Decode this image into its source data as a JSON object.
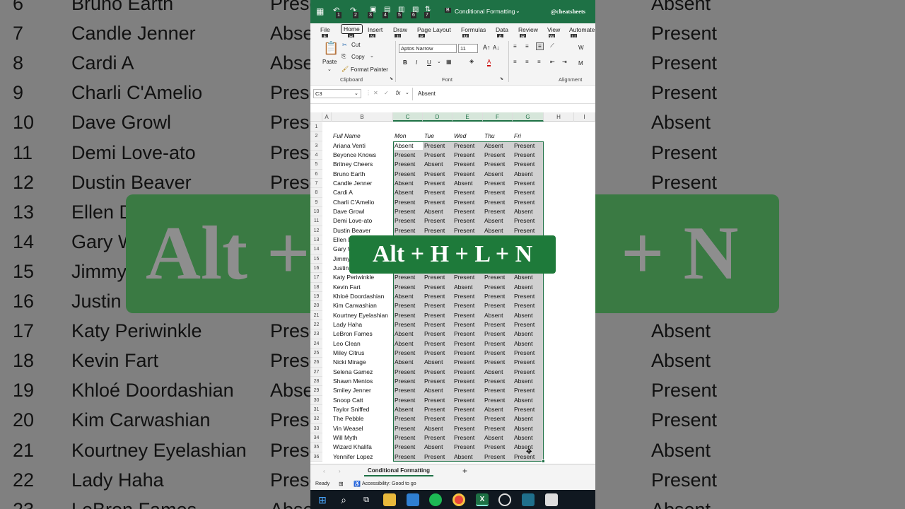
{
  "bg": {
    "rows": [
      {
        "n": "6",
        "name": "Bruno Earth",
        "c": "Present",
        "d": "Absent"
      },
      {
        "n": "7",
        "name": "Candle Jenner",
        "c": "Absent",
        "d": "Present"
      },
      {
        "n": "8",
        "name": "Cardi A",
        "c": "Absent",
        "d": "Present"
      },
      {
        "n": "9",
        "name": "Charli C'Amelio",
        "c": "Present",
        "d": "Present"
      },
      {
        "n": "10",
        "name": "Dave Growl",
        "c": "Present",
        "d": "Absent"
      },
      {
        "n": "11",
        "name": "Demi Love-ato",
        "c": "Present",
        "d": "Present"
      },
      {
        "n": "12",
        "name": "Dustin Beaver",
        "c": "Present",
        "d": "Present"
      },
      {
        "n": "13",
        "name": "Ellen D",
        "c": "",
        "d": ""
      },
      {
        "n": "14",
        "name": "Gary W",
        "c": "",
        "d": ""
      },
      {
        "n": "15",
        "name": "Jimmy",
        "c": "",
        "d": ""
      },
      {
        "n": "16",
        "name": "Justin",
        "c": "",
        "d": ""
      },
      {
        "n": "17",
        "name": "Katy Periwinkle",
        "c": "Present",
        "d": "Absent"
      },
      {
        "n": "18",
        "name": "Kevin Fart",
        "c": "Present",
        "d": "Absent"
      },
      {
        "n": "19",
        "name": "Khloé Doordashian",
        "c": "Absent",
        "d": "Present"
      },
      {
        "n": "20",
        "name": "Kim Carwashian",
        "c": "Present",
        "d": "Present"
      },
      {
        "n": "21",
        "name": "Kourtney Eyelashian",
        "c": "Present",
        "d": "Absent"
      },
      {
        "n": "22",
        "name": "Lady Haha",
        "c": "Present",
        "d": "Present"
      },
      {
        "n": "23",
        "name": "LeBron Fames",
        "c": "Absent",
        "d": "Absent"
      }
    ],
    "banner_left": "Alt +",
    "banner_right": "+ N"
  },
  "titlebar": {
    "title": "Conditional Formatting",
    "handle": "@cheatsheets",
    "keytips": [
      "1",
      "2",
      "3",
      "4",
      "5",
      "6",
      "7"
    ],
    "b": "B"
  },
  "menu": [
    {
      "label": "File",
      "kt": "F"
    },
    {
      "label": "Home",
      "kt": "H"
    },
    {
      "label": "Insert",
      "kt": "N"
    },
    {
      "label": "Draw",
      "kt": "JI"
    },
    {
      "label": "Page Layout",
      "kt": "P"
    },
    {
      "label": "Formulas",
      "kt": "M"
    },
    {
      "label": "Data",
      "kt": "A"
    },
    {
      "label": "Review",
      "kt": "R"
    },
    {
      "label": "View",
      "kt": "W"
    },
    {
      "label": "Automate",
      "kt": "U"
    }
  ],
  "ribbon": {
    "paste": "Paste",
    "cut": "Cut",
    "copy": "Copy",
    "format_painter": "Format Painter",
    "clipboard": "Clipboard",
    "font_name": "Aptos Narrow",
    "font_size": "11",
    "font": "Font",
    "alignment": "Alignment",
    "bold": "B",
    "italic": "I",
    "underline": "U",
    "wrap": "W",
    "merge": "M"
  },
  "formula": {
    "namebox": "C3",
    "fx": "fx",
    "value": "Absent"
  },
  "columns": [
    "A",
    "B",
    "C",
    "D",
    "E",
    "F",
    "G",
    "H",
    "I"
  ],
  "headers": {
    "row": "2",
    "name": "Full Name",
    "days": [
      "Mon",
      "Tue",
      "Wed",
      "Thu",
      "Fri"
    ]
  },
  "rows": [
    {
      "n": "3",
      "name": "Ariana Venti",
      "v": [
        "Absent",
        "Present",
        "Present",
        "Absent",
        "Present"
      ]
    },
    {
      "n": "4",
      "name": "Beyonce Knows",
      "v": [
        "Present",
        "Present",
        "Present",
        "Present",
        "Present"
      ]
    },
    {
      "n": "5",
      "name": "Britney Cheers",
      "v": [
        "Present",
        "Absent",
        "Present",
        "Present",
        "Present"
      ]
    },
    {
      "n": "6",
      "name": "Bruno Earth",
      "v": [
        "Present",
        "Present",
        "Present",
        "Absent",
        "Absent"
      ]
    },
    {
      "n": "7",
      "name": "Candle Jenner",
      "v": [
        "Absent",
        "Present",
        "Absent",
        "Present",
        "Present"
      ]
    },
    {
      "n": "8",
      "name": "Cardi A",
      "v": [
        "Absent",
        "Present",
        "Present",
        "Present",
        "Present"
      ]
    },
    {
      "n": "9",
      "name": "Charli C'Amelio",
      "v": [
        "Present",
        "Present",
        "Present",
        "Present",
        "Present"
      ]
    },
    {
      "n": "10",
      "name": "Dave Growl",
      "v": [
        "Present",
        "Absent",
        "Present",
        "Present",
        "Absent"
      ]
    },
    {
      "n": "11",
      "name": "Demi Love-ato",
      "v": [
        "Present",
        "Present",
        "Present",
        "Absent",
        "Present"
      ]
    },
    {
      "n": "12",
      "name": "Dustin Beaver",
      "v": [
        "Present",
        "Present",
        "Present",
        "Absent",
        "Present"
      ]
    },
    {
      "n": "13",
      "name": "Ellen D",
      "v": [
        "",
        "",
        "",
        "",
        ""
      ]
    },
    {
      "n": "14",
      "name": "Gary W",
      "v": [
        "",
        "",
        "",
        "",
        ""
      ]
    },
    {
      "n": "15",
      "name": "Jimmy",
      "v": [
        "",
        "",
        "",
        "",
        ""
      ]
    },
    {
      "n": "16",
      "name": "Justin",
      "v": [
        "",
        "",
        "",
        "",
        ""
      ]
    },
    {
      "n": "17",
      "name": "Katy Periwinkle",
      "v": [
        "Present",
        "Present",
        "Present",
        "Present",
        "Absent"
      ]
    },
    {
      "n": "18",
      "name": "Kevin Fart",
      "v": [
        "Present",
        "Present",
        "Absent",
        "Present",
        "Absent"
      ]
    },
    {
      "n": "19",
      "name": "Khloé Doordashian",
      "v": [
        "Absent",
        "Present",
        "Present",
        "Present",
        "Present"
      ]
    },
    {
      "n": "20",
      "name": "Kim Carwashian",
      "v": [
        "Present",
        "Present",
        "Present",
        "Present",
        "Present"
      ]
    },
    {
      "n": "21",
      "name": "Kourtney Eyelashian",
      "v": [
        "Present",
        "Present",
        "Present",
        "Absent",
        "Absent"
      ]
    },
    {
      "n": "22",
      "name": "Lady Haha",
      "v": [
        "Present",
        "Present",
        "Present",
        "Present",
        "Present"
      ]
    },
    {
      "n": "23",
      "name": "LeBron Fames",
      "v": [
        "Absent",
        "Present",
        "Present",
        "Present",
        "Absent"
      ]
    },
    {
      "n": "24",
      "name": "Leo Clean",
      "v": [
        "Absent",
        "Present",
        "Present",
        "Present",
        "Absent"
      ]
    },
    {
      "n": "25",
      "name": "Miley Citrus",
      "v": [
        "Present",
        "Present",
        "Present",
        "Present",
        "Present"
      ]
    },
    {
      "n": "26",
      "name": "Nicki Mirage",
      "v": [
        "Absent",
        "Absent",
        "Present",
        "Present",
        "Present"
      ]
    },
    {
      "n": "27",
      "name": "Selena Gamez",
      "v": [
        "Present",
        "Present",
        "Present",
        "Absent",
        "Present"
      ]
    },
    {
      "n": "28",
      "name": "Shawn Mentos",
      "v": [
        "Present",
        "Present",
        "Present",
        "Present",
        "Absent"
      ]
    },
    {
      "n": "29",
      "name": "Smiley Jenner",
      "v": [
        "Present",
        "Absent",
        "Present",
        "Present",
        "Present"
      ]
    },
    {
      "n": "30",
      "name": "Snoop Catt",
      "v": [
        "Present",
        "Present",
        "Present",
        "Present",
        "Absent"
      ]
    },
    {
      "n": "31",
      "name": "Taylor Sniffed",
      "v": [
        "Absent",
        "Present",
        "Present",
        "Absent",
        "Present"
      ]
    },
    {
      "n": "32",
      "name": "The Pebble",
      "v": [
        "Present",
        "Present",
        "Present",
        "Present",
        "Absent"
      ]
    },
    {
      "n": "33",
      "name": "Vin Weasel",
      "v": [
        "Present",
        "Absent",
        "Present",
        "Present",
        "Absent"
      ]
    },
    {
      "n": "34",
      "name": "Will Myth",
      "v": [
        "Present",
        "Present",
        "Present",
        "Absent",
        "Absent"
      ]
    },
    {
      "n": "35",
      "name": "Wizard Khalifa",
      "v": [
        "Present",
        "Absent",
        "Present",
        "Present",
        "Absent"
      ]
    },
    {
      "n": "36",
      "name": "Yennifer Lopez",
      "v": [
        "Present",
        "Present",
        "Absent",
        "Present",
        "Present"
      ]
    }
  ],
  "overlay": "Alt + H + L + N",
  "sheet_tab": "Conditional Formatting",
  "add_sheet": "+",
  "status": {
    "ready": "Ready",
    "accessibility": "Accessibility: Good to go"
  },
  "colors": {
    "excel_green": "#1e7145",
    "selection_gray": "#d0d0d0",
    "overlay_green": "#1e7a3a"
  }
}
